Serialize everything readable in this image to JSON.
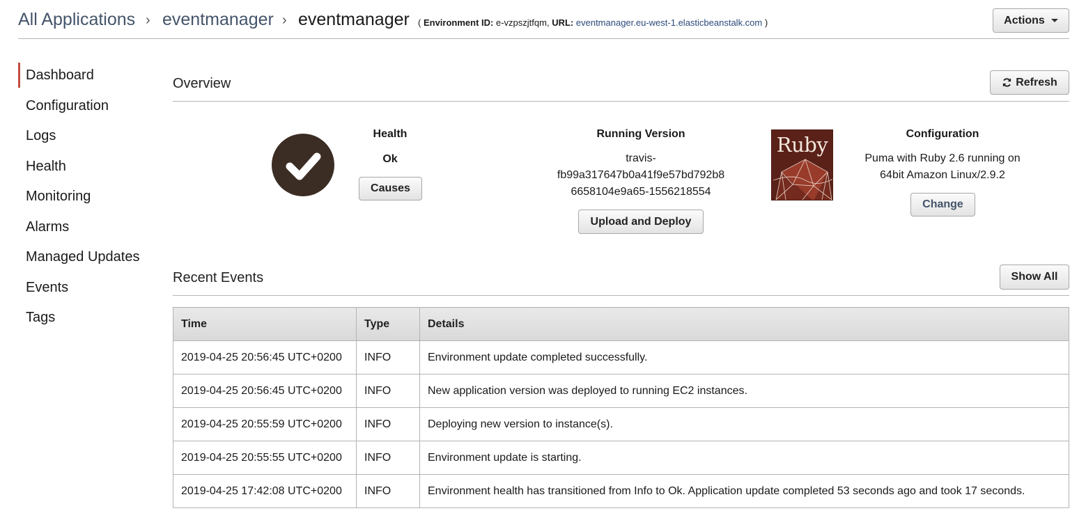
{
  "header": {
    "breadcrumb": [
      "All Applications",
      "eventmanager"
    ],
    "current": "eventmanager",
    "env_open": "(",
    "env_id_label": "Environment ID:",
    "env_id_value": "e-vzpszjtfqm,",
    "url_label": "URL:",
    "url_value": "eventmanager.eu-west-1.elasticbeanstalk.com",
    "env_close": ")",
    "actions_label": "Actions"
  },
  "sidebar": {
    "items": [
      {
        "label": "Dashboard"
      },
      {
        "label": "Configuration"
      },
      {
        "label": "Logs"
      },
      {
        "label": "Health"
      },
      {
        "label": "Monitoring"
      },
      {
        "label": "Alarms"
      },
      {
        "label": "Managed Updates"
      },
      {
        "label": "Events"
      },
      {
        "label": "Tags"
      }
    ],
    "active_index": 0
  },
  "overview": {
    "title": "Overview",
    "refresh_label": "Refresh",
    "health": {
      "title": "Health",
      "status": "Ok",
      "causes_label": "Causes"
    },
    "running_version": {
      "title": "Running Version",
      "lines": [
        "travis-",
        "fb99a317647b0a41f9e57bd792b8",
        "6658104e9a65-1556218554"
      ],
      "upload_label": "Upload and Deploy"
    },
    "configuration": {
      "title": "Configuration",
      "lines": [
        "Puma with Ruby 2.6 running on",
        "64bit Amazon Linux/2.9.2"
      ],
      "change_label": "Change",
      "logo_text": "Ruby"
    }
  },
  "recent_events": {
    "title": "Recent Events",
    "show_all_label": "Show All",
    "columns": [
      "Time",
      "Type",
      "Details"
    ],
    "rows": [
      {
        "time": "2019-04-25 20:56:45 UTC+0200",
        "type": "INFO",
        "details": "Environment update completed successfully."
      },
      {
        "time": "2019-04-25 20:56:45 UTC+0200",
        "type": "INFO",
        "details": "New application version was deployed to running EC2 instances."
      },
      {
        "time": "2019-04-25 20:55:59 UTC+0200",
        "type": "INFO",
        "details": "Deploying new version to instance(s)."
      },
      {
        "time": "2019-04-25 20:55:55 UTC+0200",
        "type": "INFO",
        "details": "Environment update is starting."
      },
      {
        "time": "2019-04-25 17:42:08 UTC+0200",
        "type": "INFO",
        "details": "Environment health has transitioned from Info to Ok. Application update completed 53 seconds ago and took 17 seconds."
      }
    ]
  },
  "icons": {
    "health": "checkmark-icon",
    "refresh": "refresh-icon",
    "actions": "caret-down-icon",
    "platform": "ruby-logo"
  },
  "colors": {
    "breadcrumb_link": "#44546a",
    "active_nav": "#c24d3e",
    "health_circle": "#3b2d24",
    "change_text": "#44546a",
    "url_link": "#2c4a7a"
  }
}
